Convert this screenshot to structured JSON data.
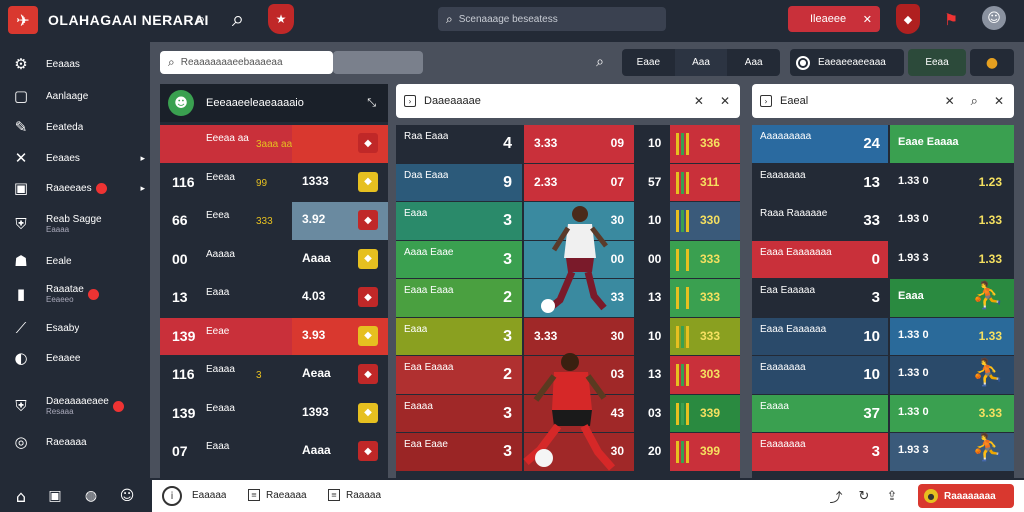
{
  "app": {
    "title": "OLAHAGAAI NERARAI"
  },
  "topbar": {
    "search_placeholder": "Scenaaage beseatess",
    "alert_button": "Ileaeee"
  },
  "sidebar": {
    "items": [
      {
        "label": "Eeaaas"
      },
      {
        "label": "Aanlaage"
      },
      {
        "label": "Eeateda"
      },
      {
        "label": "Eeaaes"
      },
      {
        "label": "Raaeeaes",
        "badge": true
      },
      {
        "label": "Reab Sagge",
        "sub": "Eaaaa"
      },
      {
        "label": "Eeale"
      },
      {
        "label": "Raaatae",
        "sub": "Eeaeeo",
        "badge": true
      },
      {
        "label": "Esaaby"
      },
      {
        "label": "Eeaaee"
      },
      {
        "label": "Daeaaaaeaee",
        "sub": "Resaaa",
        "badge": true
      },
      {
        "label": "Raeaaaa"
      }
    ]
  },
  "toolbar": {
    "search_placeholder": "Reaaaaaaaeebaaaeaa",
    "tabs": [
      "Eaae",
      "Aaa",
      "Aaa"
    ],
    "dashboard_label": "Eaeaeeaeeaaa",
    "toggle_label": "Eeaa"
  },
  "panel_left": {
    "title": "Eeeaaeeleaeaaaaio",
    "rows": [
      {
        "code": "",
        "name": "Eeeaa aa",
        "odds": "3aaa aaa",
        "val": "",
        "color": "#c9303a"
      },
      {
        "code": "116",
        "name": "Eeeaa",
        "odds": "99",
        "val": "1333",
        "color": "#232a36"
      },
      {
        "code": "66",
        "name": "Eeea",
        "odds": "333",
        "val": "3.92",
        "color": "#232a36"
      },
      {
        "code": "00",
        "name": "Aaaaa",
        "odds": "",
        "val": "Aaaa",
        "color": "#232a36"
      },
      {
        "code": "13",
        "name": "Eaaa",
        "odds": "",
        "val": "4.03",
        "color": "#232a36"
      },
      {
        "code": "139",
        "name": "Eeae",
        "odds": "",
        "val": "3.93",
        "color": "#c9303a"
      },
      {
        "code": "116",
        "name": "Eaaaa",
        "odds": "3",
        "val": "Aeaa",
        "color": "#232a36"
      },
      {
        "code": "139",
        "name": "Eeaaa",
        "odds": "",
        "val": "1393",
        "color": "#232a36"
      },
      {
        "code": "07",
        "name": "Eaaa",
        "odds": "",
        "val": "Aaaa",
        "color": "#232a36"
      }
    ]
  },
  "panel_mid": {
    "title": "Daaeaaaae",
    "rows": [
      {
        "team": "Raa Eaaa",
        "score": "4",
        "a": "3.33",
        "b": "09",
        "c": "10",
        "d": "336",
        "color": "#232a36"
      },
      {
        "team": "Daa Eaaa",
        "score": "9",
        "a": "2.33",
        "b": "07",
        "c": "57",
        "d": "311",
        "color": "#2c5a7a"
      },
      {
        "team": "Eaaa",
        "score": "3",
        "a": "",
        "b": "30",
        "c": "10",
        "d": "330",
        "color": "#2a8a6a"
      },
      {
        "team": "Aaaa Eaae",
        "score": "3",
        "a": "",
        "b": "00",
        "c": "00",
        "d": "333",
        "color": "#3aa050"
      },
      {
        "team": "Eaaa Eaaa",
        "score": "2",
        "a": "",
        "b": "33",
        "c": "13",
        "d": "333",
        "color": "#4aa040"
      },
      {
        "team": "Eaaa",
        "score": "3",
        "a": "3.33",
        "b": "30",
        "c": "10",
        "d": "333",
        "color": "#8aa020"
      },
      {
        "team": "Eaa Eaaaa",
        "score": "2",
        "a": "",
        "b": "03",
        "c": "13",
        "d": "303",
        "color": "#b03030"
      },
      {
        "team": "Eaaaa",
        "score": "3",
        "a": "",
        "b": "43",
        "c": "03",
        "d": "339",
        "color": "#a02828"
      },
      {
        "team": "Eaa Eaae",
        "score": "3",
        "a": "",
        "b": "30",
        "c": "20",
        "d": "399",
        "color": "#9a2525"
      }
    ]
  },
  "panel_right": {
    "title": "Eaeal",
    "rows": [
      {
        "name": "Aaaaaaaaa",
        "score": "24",
        "team": "Eaae Eaaaa",
        "a": "",
        "b": "",
        "color": "#2a6aa0"
      },
      {
        "name": "Eaaaaaaa",
        "score": "13",
        "team": "1.33 0",
        "a": "",
        "b": "1.23",
        "color": "#232a36"
      },
      {
        "name": "Raaa Raaaaae",
        "score": "33",
        "team": "1.93 0",
        "a": "",
        "b": "1.33",
        "color": "#232a36"
      },
      {
        "name": "Eaaa Eaaaaaaa",
        "score": "0",
        "team": "1.93 3",
        "a": "",
        "b": "1.33",
        "color": "#c9303a"
      },
      {
        "name": "Eaa Eaaaaa",
        "score": "3",
        "team": "Eaaa",
        "a": "",
        "b": "",
        "color": "#232a36"
      },
      {
        "name": "Eaaa Eaaaaaa",
        "score": "10",
        "team": "1.33 0",
        "a": "",
        "b": "1.33",
        "color": "#2a4a6a"
      },
      {
        "name": "Eaaaaaaa",
        "score": "10",
        "team": "1.33 0",
        "a": "",
        "b": "",
        "color": "#2a4a6a"
      },
      {
        "name": "Eaaaa",
        "score": "37",
        "team": "1.33 0",
        "a": "",
        "b": "3.33",
        "color": "#3aa050"
      },
      {
        "name": "Eaaaaaaa",
        "score": "3",
        "team": "1.93 3",
        "a": "",
        "b": "",
        "color": "#c9303a"
      }
    ]
  },
  "bottombar": {
    "items": [
      "Eaaaaa",
      "Raeaaaa",
      "Raaaaa"
    ],
    "cta": "Raaaaaaaa"
  },
  "colors": {
    "dark": "#232a36",
    "accent_red": "#d9382f",
    "accent_green": "#3aa050",
    "accent_yellow": "#e6c020"
  }
}
